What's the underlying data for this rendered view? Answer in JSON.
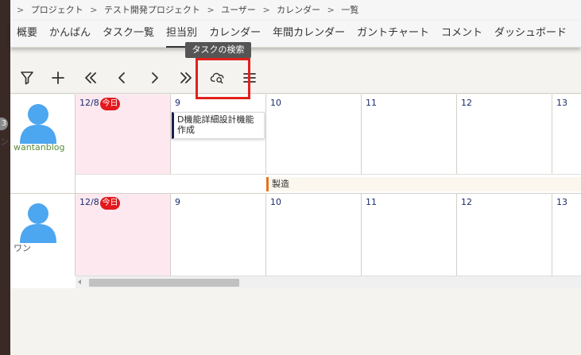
{
  "breadcrumb": [
    "プロジェクト",
    "テスト開発プロジェクト",
    "ユーザー",
    "カレンダー",
    "一覧"
  ],
  "breadcrumb_sep": ">",
  "tabs": [
    {
      "label": "概要"
    },
    {
      "label": "かんばん"
    },
    {
      "label": "タスク一覧"
    },
    {
      "label": "担当別",
      "active": true
    },
    {
      "label": "カレンダー"
    },
    {
      "label": "年間カレンダー"
    },
    {
      "label": "ガントチャート"
    },
    {
      "label": "コメント"
    },
    {
      "label": "ダッシュボード"
    }
  ],
  "tooltip": "タスクの検索",
  "toolbar": {
    "icons": [
      "filter-icon",
      "plus-icon",
      "double-chevron-left-icon",
      "chevron-left-icon",
      "chevron-right-icon",
      "double-chevron-right-icon",
      "cloud-search-icon",
      "menu-icon"
    ]
  },
  "left_strip": {
    "badge": "3",
    "char": "ン"
  },
  "calendar": {
    "today_badge": "今日",
    "rows": [
      {
        "user": "wantanblog",
        "name_color": "#5b8c3a",
        "days": [
          "12/8",
          "9",
          "10",
          "11",
          "12",
          "13"
        ],
        "task": "D機能詳細設計機能作成",
        "phase": "製造"
      },
      {
        "user": "ワン",
        "name_color": "#555555",
        "days": [
          "12/8",
          "9",
          "10",
          "11",
          "12",
          "13"
        ]
      }
    ]
  },
  "colors": {
    "today_bg": "#fde8f0",
    "today_badge": "#e3191d",
    "highlight": "#e0201c",
    "avatar": "#4da6f0",
    "task_border": "#1a1f4b",
    "phase_border": "#e8721e"
  }
}
